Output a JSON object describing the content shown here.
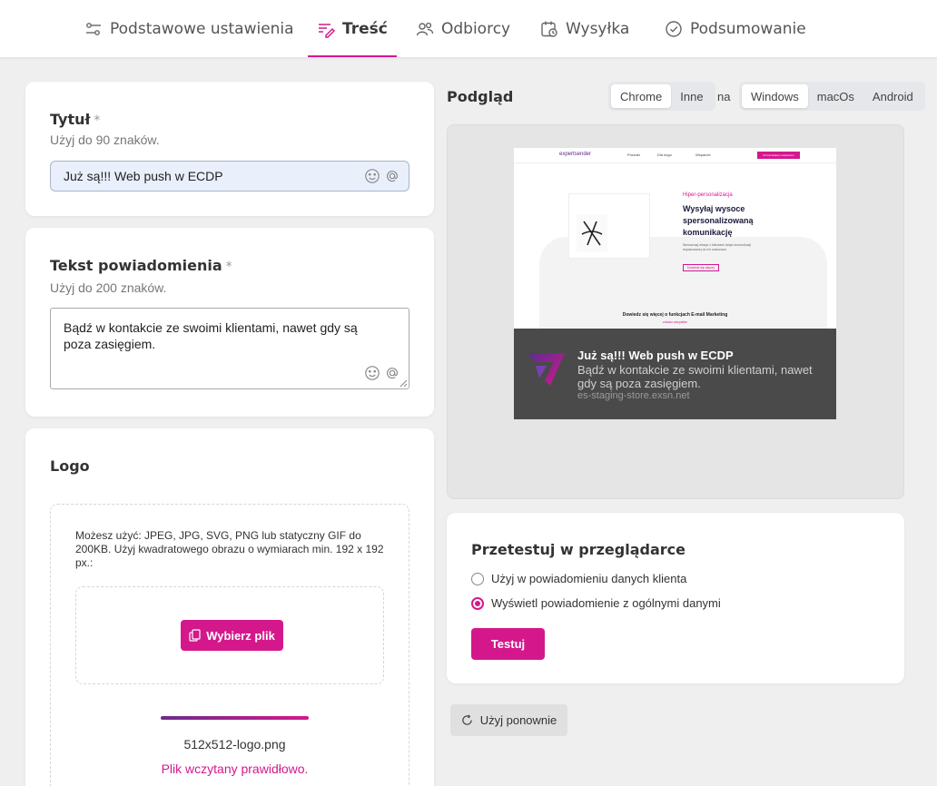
{
  "tabs": [
    {
      "label": "Podstawowe ustawienia",
      "icon": "sliders-icon"
    },
    {
      "label": "Treść",
      "icon": "edit-list-icon",
      "active": true
    },
    {
      "label": "Odbiorcy",
      "icon": "users-icon"
    },
    {
      "label": "Wysyłka",
      "icon": "calendar-clock-icon"
    },
    {
      "label": "Podsumowanie",
      "icon": "check-circle-icon"
    }
  ],
  "title_card": {
    "label": "Tytuł",
    "required": "*",
    "hint": "Użyj do 90 znaków.",
    "value": "Już są!!! Web push w ECDP"
  },
  "body_card": {
    "label": "Tekst powiadomienia",
    "required": "*",
    "hint": "Użyj do 200 znaków.",
    "value": "Bądź w kontakcie ze swoimi klientami, nawet gdy są poza zasięgiem."
  },
  "logo_card": {
    "label": "Logo",
    "info": "Możesz użyć: JPEG, JPG, SVG, PNG lub statyczny GIF do 200KB. Użyj kwadratowego obrazu o wymiarach min. 192 x 192 px.:",
    "button": "Wybierz plik",
    "filename": "512x512-logo.png",
    "status": "Plik wczytany prawidłowo.",
    "upload_progress": 1.0
  },
  "preview": {
    "label": "Podgląd",
    "browsers": [
      "Chrome",
      "Inne"
    ],
    "browser_selected": "Chrome",
    "on_label": "na",
    "systems": [
      "Windows",
      "macOs",
      "Android"
    ],
    "system_selected": "Windows",
    "notification": {
      "title": "Już są!!! Web push w ECDP",
      "body": "Bądź w kontakcie ze swoimi klientami, nawet gdy są poza zasięgiem.",
      "domain": "es-staging-store.exsn.net"
    },
    "site": {
      "logo": "expertsender",
      "nav": [
        "Produkt",
        "Dla kogo",
        "Wsparcie"
      ],
      "cta": "Porozmawiaj z ekspertem",
      "kicker": "Hiper-personalizacja",
      "headline": "Wysyłaj wysoce spersonalizowaną komunikację",
      "subtext": "Wzmacniaj relacje z klientami dzięki komunikacji dopasowanej do ich zachowań.",
      "more": "Dowiedz się więcej",
      "footer": "Dowiedz się więcej o funkcjach E-mail Marketing",
      "footer_link": "zobacz wszystkie"
    }
  },
  "test_card": {
    "label": "Przetestuj w przeglądarce",
    "options": [
      "Użyj w powiadomieniu danych klienta",
      "Wyświetl powiadomienie z ogólnymi danymi"
    ],
    "selected": 1,
    "button": "Testuj"
  },
  "reuse_button": "Użyj ponownie",
  "colors": {
    "accent": "#d4188c",
    "background": "#efefef",
    "notification_bg": "#4a4a4a"
  }
}
